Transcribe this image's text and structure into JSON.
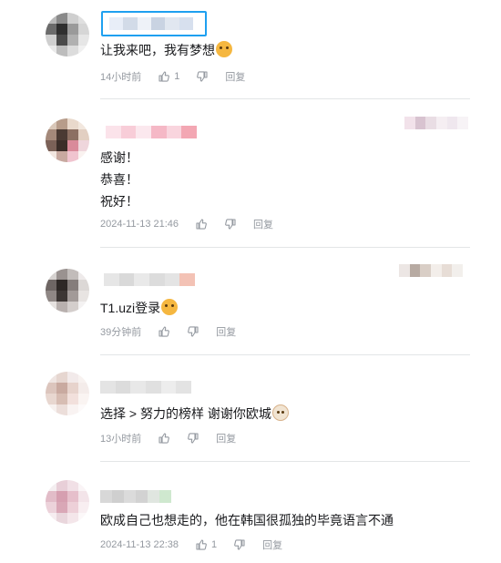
{
  "comments": [
    {
      "text": [
        "让我来吧，我有梦想"
      ],
      "emote": "cat-face-emote",
      "time": "14小时前",
      "likes": "1",
      "reply_label": "回复",
      "avatar_colors": [
        "#b9b9b9",
        "#8a8a8a",
        "#cfcfcf",
        "#e0e0e0",
        "#6b6b6b",
        "#2f2f2f",
        "#9a9a9a",
        "#d6d6d6",
        "#cfcfcf",
        "#4a4a4a",
        "#b0b0b0",
        "#e6e6e6",
        "#e9e9e9",
        "#bdbdbd",
        "#dcdcdc",
        "#f0f0f0"
      ],
      "name_colors": [
        "#e8eef8",
        "#d2dbe8",
        "#eef2f8",
        "#c9d3e2",
        "#e1e7f0",
        "#d7e0ee"
      ]
    },
    {
      "text": [
        "感谢！",
        "恭喜！",
        "祝好！"
      ],
      "emote": "",
      "time": "2024-11-13 21:46",
      "likes": "",
      "reply_label": "回复",
      "avatar_colors": [
        "#d9c7b8",
        "#b79c8a",
        "#e9d9cc",
        "#f2e7de",
        "#a4897a",
        "#4a3a33",
        "#8c6f62",
        "#e2cfc2",
        "#7b6158",
        "#3b2d29",
        "#d98a9a",
        "#efd6dc",
        "#f2e6e0",
        "#c8a9a0",
        "#f0c4cf",
        "#faf2f0"
      ],
      "name_colors": [
        "#fbe3ea",
        "#f8cdd8",
        "#fbe8ee",
        "#f5b8c6",
        "#f9d5de",
        "#f3a7b3"
      ],
      "badge_colors": [
        "#f2e2ea",
        "#d8c3d0",
        "#e9dde4",
        "#f5eef2",
        "#efe7ee",
        "#f7f3f6"
      ]
    },
    {
      "text": [
        "T1.uzi登录"
      ],
      "emote": "cat-face-emote",
      "time": "39分钟前",
      "likes": "",
      "reply_label": "回复",
      "avatar_colors": [
        "#d6d2d0",
        "#9a9290",
        "#c2bcba",
        "#eeeaea",
        "#6e6664",
        "#2e2826",
        "#857d7b",
        "#dcd8d6",
        "#8f8785",
        "#3c3634",
        "#a29a98",
        "#e8e4e2",
        "#e6e2e0",
        "#b8b0ae",
        "#d4cecc",
        "#f4f2f2"
      ],
      "name_colors": [
        "#e6e6e6",
        "#d9d9d9",
        "#e9e9e9",
        "#dcdcdc",
        "#e4e4e4",
        "#f3c2b5"
      ],
      "badge_colors": [
        "#ece6e4",
        "#b7aaa2",
        "#d9cec6",
        "#f3eeea",
        "#e7ddd6",
        "#f2efec"
      ]
    },
    {
      "text": [
        "选择 > 努力的榜样 谢谢你欧城"
      ],
      "emote": "cat-face-white-emote",
      "time": "13小时前",
      "likes": "",
      "reply_label": "回复",
      "avatar_colors": [
        "#efe5e2",
        "#e6d6d0",
        "#f2eaea",
        "#f8f2f0",
        "#dcc5bd",
        "#c9aaa0",
        "#e7d3cc",
        "#f4ecea",
        "#e8d7d0",
        "#d7bdb3",
        "#f2e0dc",
        "#faf4f2",
        "#f7f1ef",
        "#ecdeda",
        "#f9f3f2",
        "#fdfafa"
      ],
      "name_colors": [
        "#e4e4e4",
        "#dcdcdc",
        "#e8e8e8",
        "#e0e0e0",
        "#ededed",
        "#e3e3e3"
      ]
    },
    {
      "text": [
        "欧成自己也想走的，他在韩国很孤独的毕竟语言不通"
      ],
      "emote": "",
      "time": "2024-11-13 22:38",
      "likes": "1",
      "reply_label": "回复",
      "avatar_colors": [
        "#f4eef0",
        "#e8cfd8",
        "#f1e0e6",
        "#faf4f6",
        "#e2bcc8",
        "#d69fb0",
        "#e6bfcb",
        "#f3e4e9",
        "#ecd2da",
        "#d9a7b6",
        "#edd0d8",
        "#f8eef1",
        "#f6edf0",
        "#e9d6dc",
        "#f4e6ea",
        "#fcf8f9"
      ],
      "name_colors": [
        "#d8d8d8",
        "#cfcfcf",
        "#dbdbdb",
        "#d2d2d2",
        "#e0e6e0",
        "#cfe8cf"
      ]
    }
  ]
}
